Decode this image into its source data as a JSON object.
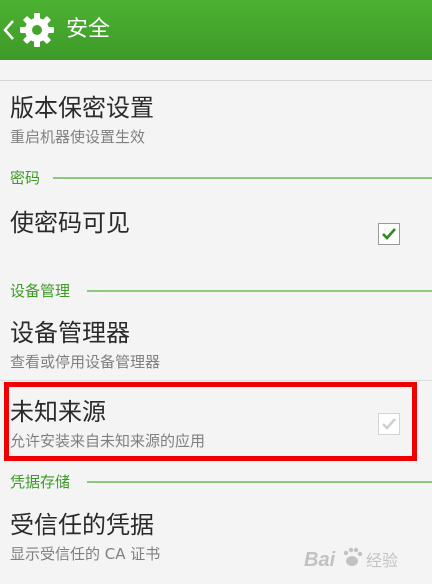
{
  "header": {
    "title": "安全",
    "back_icon": "chevron-left-icon",
    "app_icon": "gear-icon",
    "color": "#43a52c"
  },
  "items": {
    "version_security": {
      "title": "版本保密设置",
      "summary": "重启机器使设置生效"
    },
    "show_password": {
      "title": "使密码可见",
      "checked": true
    },
    "device_admin": {
      "title": "设备管理器",
      "summary": "查看或停用设备管理器"
    },
    "unknown_sources": {
      "title": "未知来源",
      "summary": "允许安装来自未知来源的应用",
      "checked": true,
      "enabled": false
    },
    "trusted_credentials": {
      "title": "受信任的凭据",
      "summary": "显示受信任的 CA 证书"
    }
  },
  "categories": {
    "password": "密码",
    "device_management": "设备管理",
    "credential_storage": "凭据存储"
  },
  "colors": {
    "accent": "#3c9a26",
    "highlight": "#ee0000"
  },
  "watermark": {
    "brand": "Bai",
    "suffix": "经验"
  }
}
